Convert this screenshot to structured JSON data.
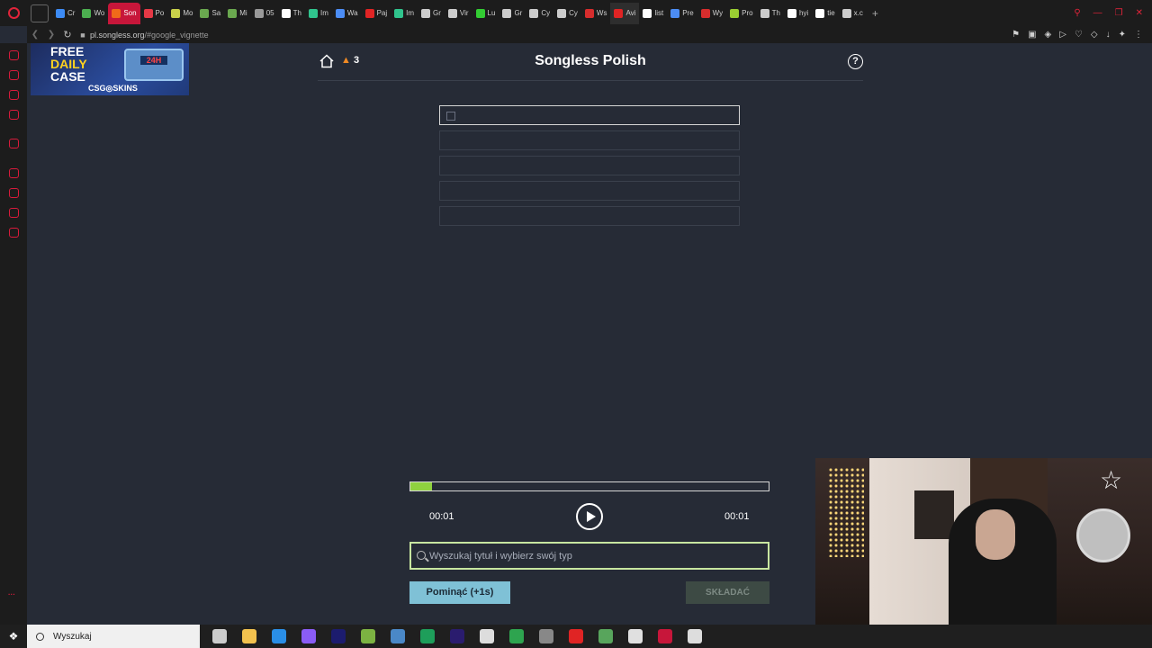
{
  "browser": {
    "tabs": [
      {
        "label": "Cr",
        "color": "#3d8bf5"
      },
      {
        "label": "Wo",
        "color": "#4caf50"
      },
      {
        "label": "Son",
        "color": "#f06a1a",
        "active": true
      },
      {
        "label": "Po",
        "color": "#e63946"
      },
      {
        "label": "Mo",
        "color": "#c9d14a"
      },
      {
        "label": "Sa",
        "color": "#6aa84f"
      },
      {
        "label": "Mi",
        "color": "#6aa84f"
      },
      {
        "label": "05",
        "color": "#999999"
      },
      {
        "label": "Th",
        "color": "#ffffff"
      },
      {
        "label": "Im",
        "color": "#30c48d"
      },
      {
        "label": "Wa",
        "color": "#4c8df5"
      },
      {
        "label": "Paj",
        "color": "#e02424"
      },
      {
        "label": "Im",
        "color": "#30c48d"
      },
      {
        "label": "Gr",
        "color": "#cccccc"
      },
      {
        "label": "Vir",
        "color": "#cccccc"
      },
      {
        "label": "Lu",
        "color": "#33cc33"
      },
      {
        "label": "Gr",
        "color": "#cccccc"
      },
      {
        "label": "Cy",
        "color": "#cccccc"
      },
      {
        "label": "Cy",
        "color": "#cccccc"
      },
      {
        "label": "Ws",
        "color": "#d62d2d"
      },
      {
        "label": "Avi",
        "color": "#e02424",
        "active2": true
      },
      {
        "label": "list",
        "color": "#ffffff"
      },
      {
        "label": "Pre",
        "color": "#4c8df5"
      },
      {
        "label": "Wy",
        "color": "#d62d2d"
      },
      {
        "label": "Pro",
        "color": "#9acd32"
      },
      {
        "label": "Th",
        "color": "#cccccc"
      },
      {
        "label": "hyi",
        "color": "#ffffff"
      },
      {
        "label": "tie",
        "color": "#ffffff"
      },
      {
        "label": "x.c",
        "color": "#cccccc"
      }
    ],
    "url_host": "pl.songless.org",
    "url_path": "/#google_vignette"
  },
  "ad": {
    "line1": "FREE",
    "line2": "DAILY",
    "line3": "CASE",
    "timer": "24H",
    "brand": "CSG◎SKINS"
  },
  "game": {
    "title": "Songless Polish",
    "streak": "3",
    "progress": 0.06,
    "time_elapsed": "00:01",
    "time_total": "00:01",
    "search_placeholder": "Wyszukaj tytuł i wybierz swój typ",
    "skip_label": "Pominąć (+1s)",
    "submit_label": "SKŁADAĆ"
  },
  "taskbar": {
    "search_label": "Wyszukaj",
    "icons": [
      {
        "name": "task-view-icon",
        "color": "#cccccc"
      },
      {
        "name": "file-explorer-icon",
        "color": "#f2c14e"
      },
      {
        "name": "vs-code-icon",
        "color": "#2a8ee6"
      },
      {
        "name": "obsidian-icon",
        "color": "#8a5cf5"
      },
      {
        "name": "after-effects-icon",
        "color": "#1c1c6e"
      },
      {
        "name": "app-green-icon",
        "color": "#7cb342"
      },
      {
        "name": "steam-icon",
        "color": "#4a88c7"
      },
      {
        "name": "excel-icon",
        "color": "#1e9e5a"
      },
      {
        "name": "premiere-icon",
        "color": "#2a1c6e"
      },
      {
        "name": "steelseries-icon",
        "color": "#dddddd"
      },
      {
        "name": "razer-icon",
        "color": "#2ea44f"
      },
      {
        "name": "app-gray-icon",
        "color": "#888888"
      },
      {
        "name": "discord-icon",
        "color": "#e02424"
      },
      {
        "name": "app-stack-icon",
        "color": "#58a55c"
      },
      {
        "name": "app-white-icon",
        "color": "#e0e0e0"
      },
      {
        "name": "opera-taskbar-icon",
        "color": "#c7163a"
      },
      {
        "name": "app-ring-icon",
        "color": "#dddddd"
      }
    ]
  }
}
